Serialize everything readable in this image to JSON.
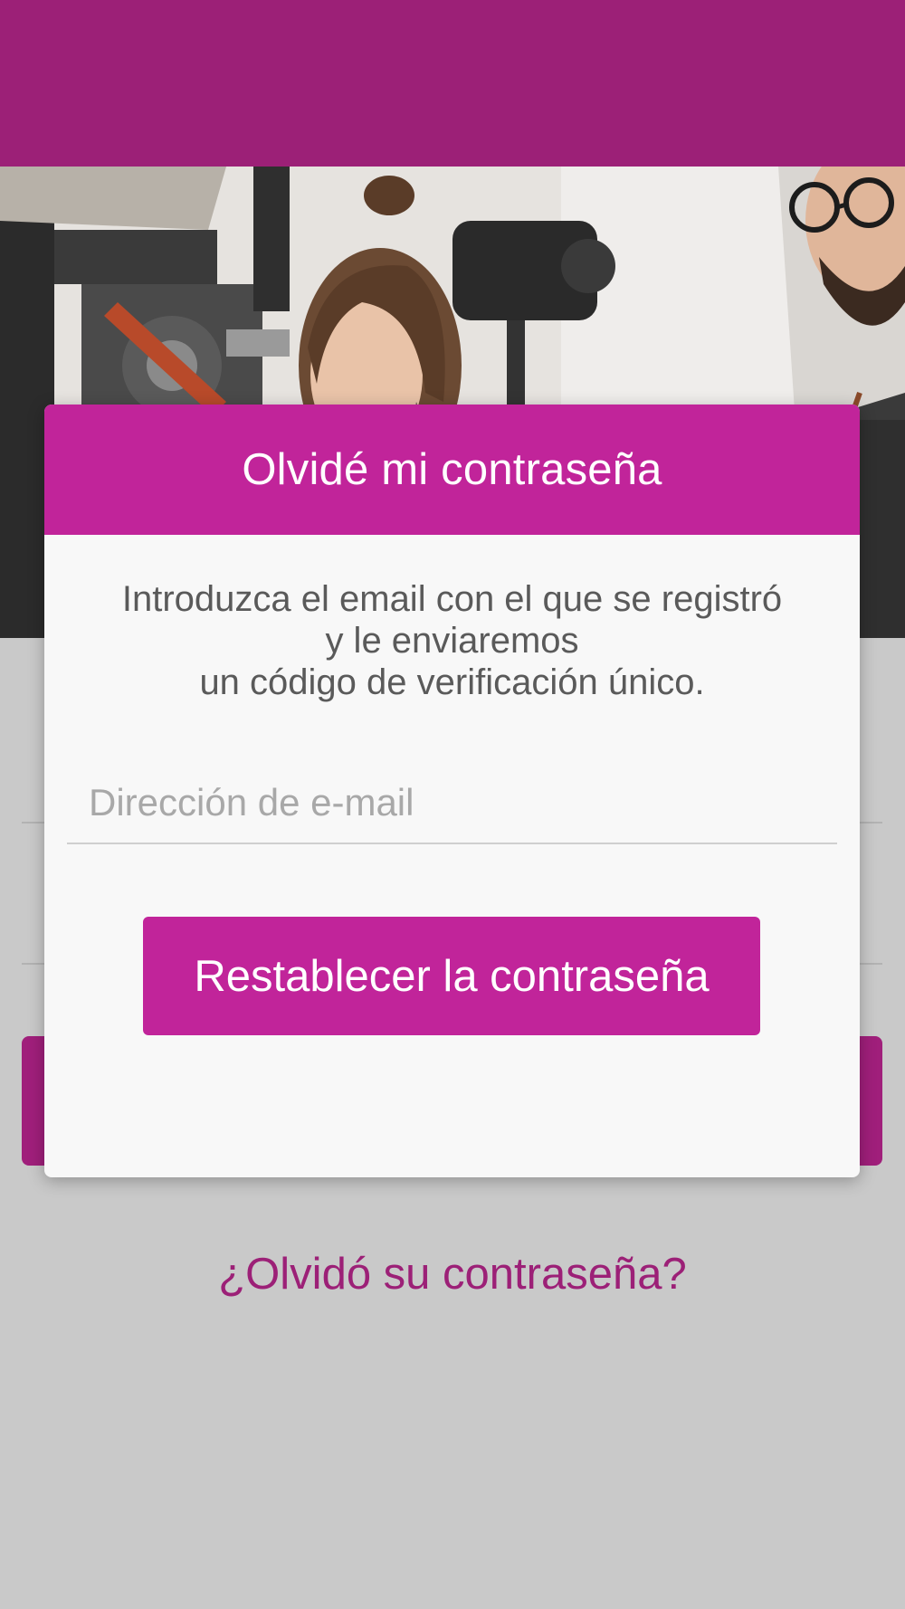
{
  "colors": {
    "top_bar": "#9c2077",
    "modal_header": "#c1249a",
    "primary_button": "#c1249a",
    "link": "#9c2077",
    "page_background": "#c9c9c9"
  },
  "hero": {
    "icon": "baristas-photo"
  },
  "modal": {
    "title": "Olvidé mi contraseña",
    "description_lines": [
      "Introduzca el email con el que se registró",
      "y le enviaremos",
      "un código de verificación único."
    ],
    "email": {
      "value": "",
      "placeholder": "Dirección de e-mail"
    },
    "reset_button_label": "Restablecer la contraseña"
  },
  "login": {
    "forgot_password_link": "¿Olvidó su contraseña?"
  }
}
